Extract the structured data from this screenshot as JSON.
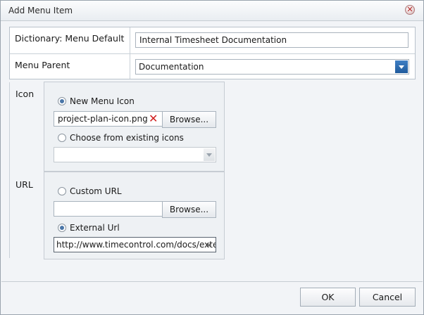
{
  "window": {
    "title": "Add Menu Item",
    "close_icon": "close-icon"
  },
  "form": {
    "dictionary_label": "Dictionary: Menu Default",
    "dictionary_value": "Internal Timesheet Documentation",
    "parent_label": "Menu Parent",
    "parent_value": "Documentation"
  },
  "icon_section": {
    "label": "Icon",
    "new_icon_option": "New Menu Icon",
    "new_icon_selected": true,
    "file_value": "project-plan-icon.png",
    "browse_label": "Browse...",
    "existing_option": "Choose from existing icons",
    "existing_selected": false,
    "existing_value": ""
  },
  "url_section": {
    "label": "URL",
    "custom_option": "Custom URL",
    "custom_selected": false,
    "custom_value": "",
    "browse_label": "Browse...",
    "external_option": "External Url",
    "external_selected": true,
    "external_value": "http://www.timecontrol.com/docs/exterı",
    "clear_glyph": "×"
  },
  "footer": {
    "ok_label": "OK",
    "cancel_label": "Cancel"
  },
  "colors": {
    "accent": "#1f5a9c",
    "error": "#d02020"
  }
}
